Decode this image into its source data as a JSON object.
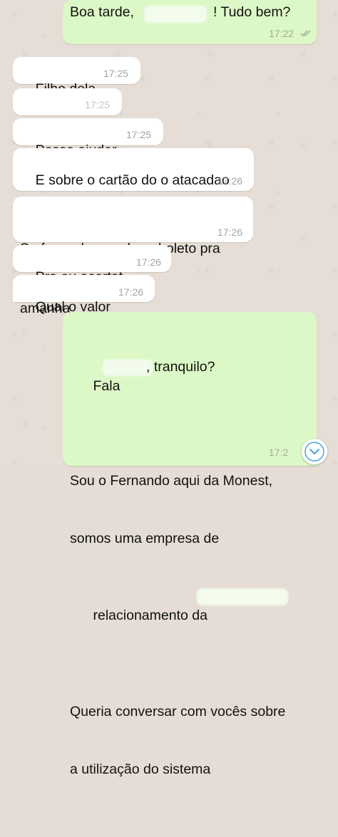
{
  "chat": {
    "messages": [
      {
        "id": "m1",
        "direction": "outgoing",
        "text_before": "Boa tarde, ",
        "text_after": "! Tudo bem?",
        "time": "17:22",
        "status": "read"
      },
      {
        "id": "m2",
        "direction": "incoming",
        "text": "Filho dela",
        "time": "17:25"
      },
      {
        "id": "m3",
        "direction": "incoming",
        "text": "",
        "time": "17:25"
      },
      {
        "id": "m4",
        "direction": "incoming",
        "text": "Posso ajudar",
        "time": "17:25"
      },
      {
        "id": "m5",
        "direction": "incoming",
        "text": "E sobre o cartão do o atacadao",
        "time": "17:26"
      },
      {
        "id": "m6",
        "direction": "incoming",
        "line1": "Se for pode mandar o boleto pra",
        "line2": "amanha",
        "time": "17:26"
      },
      {
        "id": "m7",
        "direction": "incoming",
        "text": "Pra eu acertat",
        "time": "17:26"
      },
      {
        "id": "m8",
        "direction": "incoming",
        "text": "Qual o valor",
        "time": "17:26"
      },
      {
        "id": "m9",
        "direction": "outgoing",
        "line1_before": "Fala ",
        "line1_after": ", tranquilo?",
        "line2": "Sou o Fernando aqui da Monest,",
        "line3": "somos uma empresa de",
        "line4": "relacionamento da",
        "line5": "Queria conversar com vocês sobre",
        "line6": "a utilização do sistema",
        "time": "17:2"
      }
    ]
  },
  "icons": {
    "read_receipt": "double-check-icon",
    "scroll_down": "chevron-down-icon"
  },
  "colors": {
    "incoming_bubble": "#ffffff",
    "outgoing_bubble": "#dcf8c6",
    "background": "#e5ddd5",
    "accent": "#4aa3df"
  }
}
